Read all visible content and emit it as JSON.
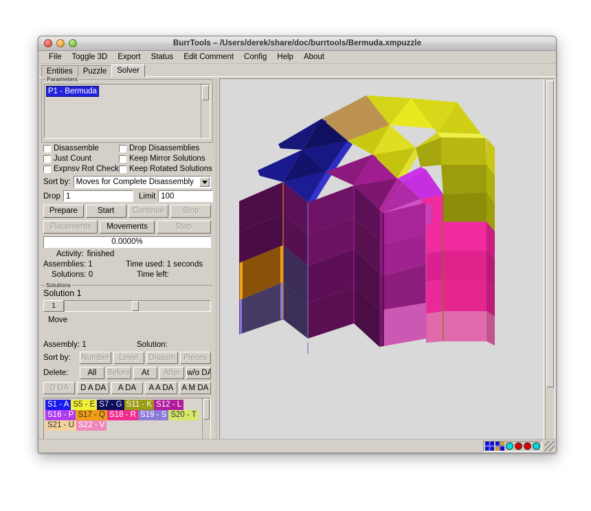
{
  "window": {
    "title": "BurrTools – /Users/derek/share/doc/burrtools/Bermuda.xmpuzzle",
    "traffic": {
      "close": "close-button",
      "minimize": "minimize-button",
      "maximize": "maximize-button"
    }
  },
  "menubar": {
    "items": [
      {
        "label": "File"
      },
      {
        "label": "Toggle 3D"
      },
      {
        "label": "Export"
      },
      {
        "label": "Status"
      },
      {
        "label": "Edit Comment"
      },
      {
        "label": "Config"
      },
      {
        "label": "Help"
      },
      {
        "label": "About"
      }
    ]
  },
  "tabs": [
    {
      "label": "Entities",
      "active": false
    },
    {
      "label": "Puzzle",
      "active": false
    },
    {
      "label": "Solver",
      "active": true
    }
  ],
  "parameters": {
    "group_title": "Parameters",
    "selected_item": "P1 - Bermuda",
    "checkboxes": [
      {
        "label": "Disassemble",
        "checked": false
      },
      {
        "label": "Drop Disassemblies",
        "checked": false
      },
      {
        "label": "Just Count",
        "checked": false
      },
      {
        "label": "Keep Mirror Solutions",
        "checked": false
      },
      {
        "label": "Expnsv Rot Check",
        "checked": false
      },
      {
        "label": "Keep Rotated Solutions",
        "checked": false
      }
    ],
    "sort_by_label": "Sort by:",
    "sort_by_value": "Moves for Complete Disassembly",
    "drop_label": "Drop",
    "drop_value": "1",
    "limit_label": "Limit",
    "limit_value": "100",
    "buttons_row1": [
      {
        "label": "Prepare",
        "disabled": false
      },
      {
        "label": "Start",
        "disabled": false
      },
      {
        "label": "Continue",
        "disabled": true
      },
      {
        "label": "Stop",
        "disabled": true
      }
    ],
    "buttons_row2": [
      {
        "label": "Placements",
        "disabled": true
      },
      {
        "label": "Movements",
        "disabled": false
      },
      {
        "label": "Step",
        "disabled": true
      }
    ],
    "progress_text": "0.0000%",
    "activity_label": "Activity:",
    "activity_value": "finished",
    "assemblies_label": "Assemblies:",
    "assemblies_value": "1",
    "time_used_label": "Time used:",
    "time_used_value": "1 seconds",
    "solutions_label": "Solutions:",
    "solutions_value": "0",
    "time_left_label": "Time left:",
    "time_left_value": ""
  },
  "solutions": {
    "group_title": "Solutions",
    "heading": "Solution 1",
    "slider_value": "1",
    "move_label": "Move",
    "assembly_label": "Assembly:",
    "assembly_value": "1",
    "solution_label": "Solution:",
    "solution_value": "",
    "sort_by_label": "Sort by:",
    "sort_buttons": [
      {
        "label": "Number",
        "disabled": true
      },
      {
        "label": "Level",
        "disabled": true
      },
      {
        "label": "Disasm",
        "disabled": true
      },
      {
        "label": "Pieces",
        "disabled": true
      }
    ],
    "delete_label": "Delete:",
    "delete_buttons": [
      {
        "label": "All",
        "disabled": false
      },
      {
        "label": "Before",
        "disabled": true
      },
      {
        "label": "At",
        "disabled": false
      },
      {
        "label": "After",
        "disabled": true
      },
      {
        "label": "w/o DA",
        "disabled": false
      }
    ],
    "da_buttons": [
      {
        "label": "D DA",
        "disabled": true
      },
      {
        "label": "D A DA",
        "disabled": false
      },
      {
        "label": "A DA",
        "disabled": false
      },
      {
        "label": "A A DA",
        "disabled": false
      },
      {
        "label": "A M DA",
        "disabled": false
      }
    ],
    "pieces": [
      {
        "label": "S1 - A",
        "bg": "#1a1aee",
        "fg": "#ffffff"
      },
      {
        "label": "S5 - E",
        "bg": "#f0f035",
        "fg": "#333333"
      },
      {
        "label": "S7 - G",
        "bg": "#0d0d5c",
        "fg": "#e8e8e8"
      },
      {
        "label": "S11 - K",
        "bg": "#9a9a14",
        "fg": "#ffffff"
      },
      {
        "label": "S12 - L",
        "bg": "#b01b9c",
        "fg": "#ffffff"
      },
      {
        "label": "S16 - P",
        "bg": "#b03bf0",
        "fg": "#ffffff"
      },
      {
        "label": "S17 - Q",
        "bg": "#f09e14",
        "fg": "#333333"
      },
      {
        "label": "S18 - R",
        "bg": "#ef2b8b",
        "fg": "#ffffff"
      },
      {
        "label": "S19 - S",
        "bg": "#8b7bd8",
        "fg": "#ffffff"
      },
      {
        "label": "S20 - T",
        "bg": "#d5e86a",
        "fg": "#333333"
      },
      {
        "label": "S21 - U",
        "bg": "#f4d39a",
        "fg": "#333333"
      },
      {
        "label": "S22 - V",
        "bg": "#ee88bb",
        "fg": "#ffffff"
      }
    ]
  },
  "statusbar": {
    "icons": [
      {
        "name": "grid-view-icon"
      },
      {
        "name": "grid-color-view-icon"
      },
      {
        "name": "status-dot-1",
        "color": "#00dddd"
      },
      {
        "name": "status-dot-2",
        "color": "#dd0000"
      },
      {
        "name": "status-dot-3",
        "color": "#dd0000"
      },
      {
        "name": "status-dot-4",
        "color": "#00dddd"
      }
    ],
    "resize_grip": "resize-grip"
  },
  "viewport": {
    "name": "3d-puzzle-view",
    "background": "#d9d9d9",
    "model_title": "Bermuda triangular-prism puzzle assembly"
  }
}
